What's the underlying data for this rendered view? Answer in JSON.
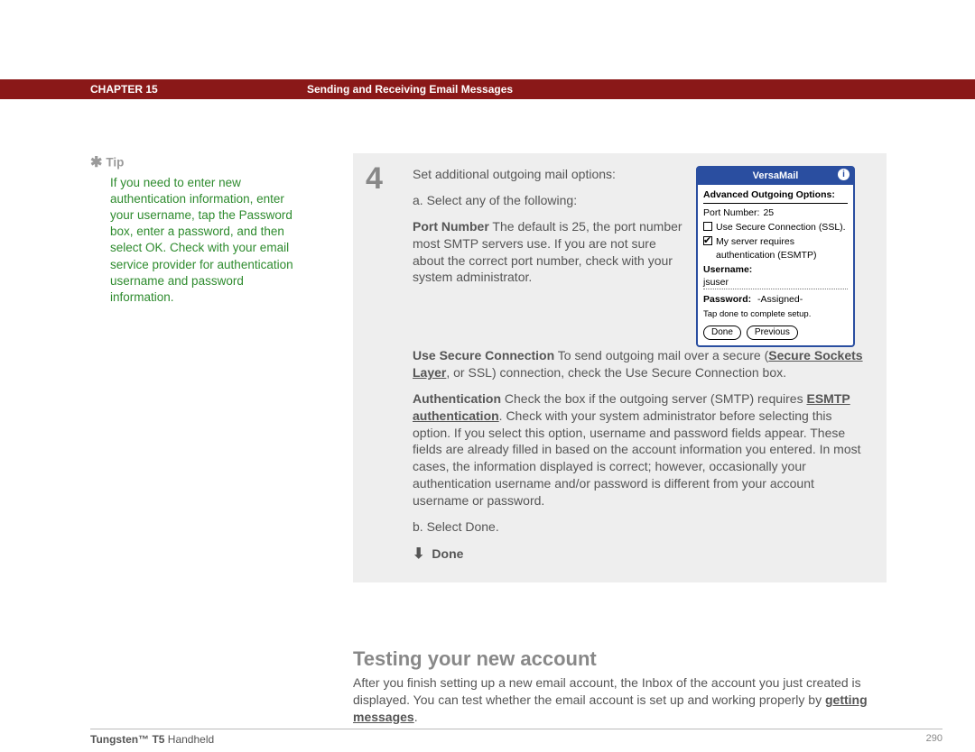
{
  "header": {
    "chapter": "CHAPTER 15",
    "title": "Sending and Receiving Email Messages"
  },
  "tip": {
    "label": "Tip",
    "body": "If you need to enter new authentication information, enter your username, tap the Password box, enter a password, and then select OK. Check with your email service provider for authentication username and password information."
  },
  "step": {
    "num": "4",
    "intro": "Set additional outgoing mail options:",
    "a": "a.  Select any of the following:",
    "port_lead": "Port Number",
    "port_text": "   The default is 25, the port number most SMTP servers use. If you are not sure about the correct port number, check with your system administrator.",
    "usc_lead": "Use Secure Connection",
    "usc_pre": "   To send outgoing mail over a secure (",
    "usc_link": "Secure Sockets Layer",
    "usc_post": ", or SSL) connection, check the Use Secure Connection box.",
    "auth_lead": "Authentication",
    "auth_pre": "   Check the box if the outgoing server (SMTP) requires ",
    "auth_link": "ESMTP authentication",
    "auth_post": ". Check with your system administrator before selecting this option. If you select this option, username and password fields appear. These fields are already filled in based on the account information you entered. In most cases, the information displayed is correct; however, occasionally your authentication username and/or password is different from your account username or password.",
    "b": "b.  Select Done.",
    "done": "Done"
  },
  "palm": {
    "title": "VersaMail",
    "heading": "Advanced Outgoing Options:",
    "port_label": "Port Number:",
    "port_value": "25",
    "ssl_label": "Use Secure Connection (SSL).",
    "auth_label_1": "My server requires",
    "auth_label_2": "authentication (ESMTP)",
    "username_label": "Username:",
    "username_value": "jsuser",
    "password_label": "Password:",
    "password_value": "-Assigned-",
    "hint": "Tap done to complete setup.",
    "btn_done": "Done",
    "btn_prev": "Previous"
  },
  "testing": {
    "heading": "Testing your new account",
    "p_pre": "After you finish setting up a new email account, the Inbox of the account you just created is displayed. You can test whether the email account is set up and working properly by ",
    "p_link": "getting messages",
    "p_post": "."
  },
  "footer": {
    "product_bold": "Tungsten™ T5",
    "product_rest": " Handheld",
    "page": "290"
  }
}
